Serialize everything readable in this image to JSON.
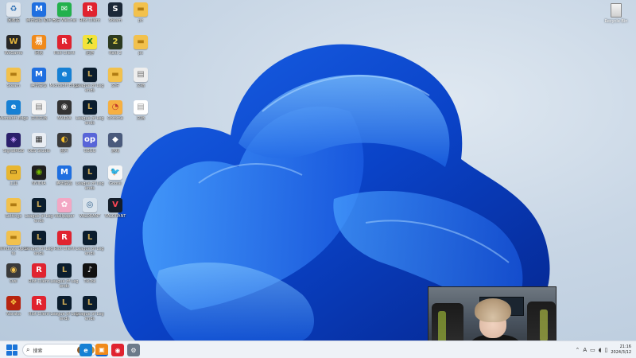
{
  "desktop": {
    "icons": [
      {
        "label": "回收站",
        "color": "#dfe6ee",
        "glyph": "♻",
        "tc": "#2d6fb3"
      },
      {
        "label": "腾讯会议 助手",
        "color": "#1f6fe0",
        "glyph": "M",
        "tc": "#fff"
      },
      {
        "label": "微信 WeChat",
        "color": "#22b14c",
        "glyph": "✉",
        "tc": "#fff"
      },
      {
        "label": "Riot Client",
        "color": "#e0232f",
        "glyph": "R",
        "tc": "#fff"
      },
      {
        "label": "Steam",
        "color": "#1b2838",
        "glyph": "S",
        "tc": "#fff"
      },
      {
        "label": "pc",
        "color": "#f2c14d",
        "glyph": "▬",
        "tc": "#b07b12"
      },
      {
        "label": "WeGame",
        "color": "#272727",
        "glyph": "W",
        "tc": "#e7b73b"
      },
      {
        "label": "网易",
        "color": "#f08a1b",
        "glyph": "易",
        "tc": "#fff"
      },
      {
        "label": "Riot Client",
        "color": "#e0232f",
        "glyph": "R",
        "tc": "#fff"
      },
      {
        "label": "迅游",
        "color": "#f4e23a",
        "glyph": "X",
        "tc": "#1b7a1b"
      },
      {
        "label": "Raid 2",
        "color": "#2c3a20",
        "glyph": "2",
        "tc": "#e8d64c"
      },
      {
        "label": "pc",
        "color": "#f2c14d",
        "glyph": "▬",
        "tc": "#b07b12"
      },
      {
        "label": "Steam",
        "color": "#f2c14d",
        "glyph": "▬",
        "tc": "#b07b12"
      },
      {
        "label": "腾讯会议",
        "color": "#1f6fe0",
        "glyph": "M",
        "tc": "#fff"
      },
      {
        "label": "Microsoft Edge",
        "color": "#1680d4",
        "glyph": "e",
        "tc": "#fff"
      },
      {
        "label": "League of Legends",
        "color": "#0b1d2e",
        "glyph": "L",
        "tc": "#c8a653"
      },
      {
        "label": "文件",
        "color": "#f2c14d",
        "glyph": "▬",
        "tc": "#b07b12"
      },
      {
        "label": "文档",
        "color": "#eeeeee",
        "glyph": "▤",
        "tc": "#777"
      },
      {
        "label": "Microsoft Edge",
        "color": "#1680d4",
        "glyph": "e",
        "tc": "#fff"
      },
      {
        "label": "文本文档",
        "color": "#f4f4f4",
        "glyph": "▤",
        "tc": "#777"
      },
      {
        "label": "NVIDIA",
        "color": "#333333",
        "glyph": "◉",
        "tc": "#ddd"
      },
      {
        "label": "League of Legends",
        "color": "#0b1d2e",
        "glyph": "L",
        "tc": "#c8a653"
      },
      {
        "label": "Chrome",
        "color": "#f6b042",
        "glyph": "◔",
        "tc": "#c0392b"
      },
      {
        "label": "文档",
        "color": "#ffffff",
        "glyph": "▤",
        "tc": "#999"
      },
      {
        "label": "SignalRGB",
        "color": "#2a1f6b",
        "glyph": "◈",
        "tc": "#c59cff"
      },
      {
        "label": "OBS Studio",
        "color": "#e9eef4",
        "glyph": "▦",
        "tc": "#333"
      },
      {
        "label": "图片",
        "color": "#3a3a3a",
        "glyph": "◐",
        "tc": "#f5c02e"
      },
      {
        "label": "OBGG",
        "color": "#5865d8",
        "glyph": "op",
        "tc": "#fff"
      },
      {
        "label": "游戏",
        "color": "#4a5a7c",
        "glyph": "◆",
        "tc": "#fff"
      },
      {
        "label": "",
        "color": "transparent",
        "glyph": "",
        "tc": "#fff"
      },
      {
        "label": "工具",
        "color": "#e8b630",
        "glyph": "▭",
        "tc": "#000"
      },
      {
        "label": "NVIDIA",
        "color": "#1f1f1f",
        "glyph": "◉",
        "tc": "#76b900"
      },
      {
        "label": "腾讯会议",
        "color": "#1f6fe0",
        "glyph": "M",
        "tc": "#fff"
      },
      {
        "label": "League of Legends",
        "color": "#0b1d2e",
        "glyph": "L",
        "tc": "#c8a653"
      },
      {
        "label": "Goose",
        "color": "#f7f7f7",
        "glyph": "🐦",
        "tc": "#333"
      },
      {
        "label": "",
        "color": "transparent",
        "glyph": "",
        "tc": "#fff"
      },
      {
        "label": "Settings",
        "color": "#f2c14d",
        "glyph": "▬",
        "tc": "#b07b12"
      },
      {
        "label": "League of Legends",
        "color": "#0b1d2e",
        "glyph": "L",
        "tc": "#c8a653"
      },
      {
        "label": "Wallpaper",
        "color": "#f3a7c4",
        "glyph": "✿",
        "tc": "#fff"
      },
      {
        "label": "VALORANT",
        "color": "#d9e3ec",
        "glyph": "◎",
        "tc": "#2d5d8a"
      },
      {
        "label": "VALORANT",
        "color": "#141e2a",
        "glyph": "V",
        "tc": "#ff4655"
      },
      {
        "label": "",
        "color": "transparent",
        "glyph": "",
        "tc": "#fff"
      },
      {
        "label": "Windows Update",
        "color": "#f2c14d",
        "glyph": "▬",
        "tc": "#b07b12"
      },
      {
        "label": "League of Legends",
        "color": "#0b1d2e",
        "glyph": "L",
        "tc": "#c8a653"
      },
      {
        "label": "Riot Client",
        "color": "#e0232f",
        "glyph": "R",
        "tc": "#fff"
      },
      {
        "label": "League of Legends",
        "color": "#0b1d2e",
        "glyph": "L",
        "tc": "#c8a653"
      },
      {
        "label": "",
        "color": "transparent",
        "glyph": "",
        "tc": "#fff"
      },
      {
        "label": "",
        "color": "transparent",
        "glyph": "",
        "tc": "#fff"
      },
      {
        "label": "Owl",
        "color": "#3a3a3a",
        "glyph": "◉",
        "tc": "#f2c14d"
      },
      {
        "label": "Riot Client",
        "color": "#e0232f",
        "glyph": "R",
        "tc": "#fff"
      },
      {
        "label": "League of Legends",
        "color": "#0b1d2e",
        "glyph": "L",
        "tc": "#c8a653"
      },
      {
        "label": "TikTok",
        "color": "#111111",
        "glyph": "♪",
        "tc": "#fff"
      },
      {
        "label": "",
        "color": "transparent",
        "glyph": "",
        "tc": "#fff"
      },
      {
        "label": "",
        "color": "transparent",
        "glyph": "",
        "tc": "#fff"
      },
      {
        "label": "Naraka",
        "color": "#b7240f",
        "glyph": "❖",
        "tc": "#f7c542"
      },
      {
        "label": "Riot Client",
        "color": "#e0232f",
        "glyph": "R",
        "tc": "#fff"
      },
      {
        "label": "League of Legends",
        "color": "#0b1d2e",
        "glyph": "L",
        "tc": "#c8a653"
      },
      {
        "label": "League of Legends",
        "color": "#0b1d2e",
        "glyph": "L",
        "tc": "#c8a653"
      },
      {
        "label": "",
        "color": "transparent",
        "glyph": "",
        "tc": "#fff"
      },
      {
        "label": "",
        "color": "transparent",
        "glyph": "",
        "tc": "#fff"
      }
    ],
    "right_icon_label": "Recycle Bin"
  },
  "taskbar": {
    "search_text": "搜索",
    "apps": [
      {
        "name": "browser-edge",
        "color": "#1680d4",
        "glyph": "e"
      },
      {
        "name": "app-orange",
        "color": "#f08a1b",
        "glyph": "▣"
      },
      {
        "name": "app-red",
        "color": "#e0232f",
        "glyph": "◉"
      },
      {
        "name": "app-settings",
        "color": "#6c7a8a",
        "glyph": "⚙"
      }
    ],
    "tray_lang": "A",
    "clock_time": "21:16",
    "clock_date": "2024/3/12"
  }
}
